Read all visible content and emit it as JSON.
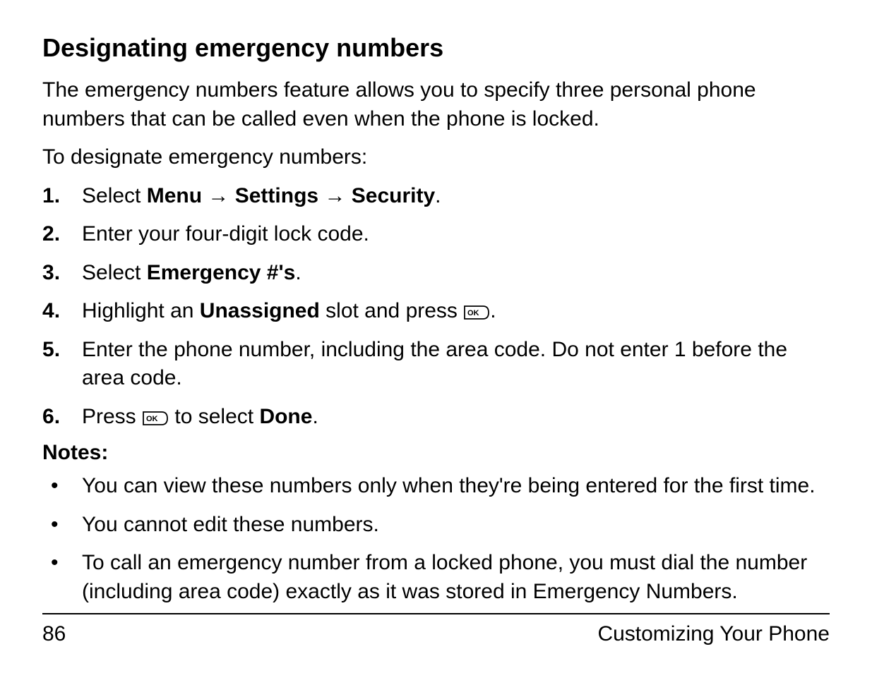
{
  "section_title": "Designating emergency numbers",
  "intro": "The emergency numbers feature allows you to specify three personal phone numbers that can be called even when the phone is locked.",
  "lead_in": "To designate emergency numbers:",
  "arrow": "→",
  "steps": {
    "s1": {
      "t1": "Select ",
      "b1": "Menu",
      "t2": " ",
      "b2": "Settings",
      "t3": " ",
      "b3": "Security",
      "t4": "."
    },
    "s2": {
      "t1": "Enter your four-digit lock code."
    },
    "s3": {
      "t1": "Select ",
      "b1": "Emergency #'s",
      "t2": "."
    },
    "s4": {
      "t1": "Highlight an ",
      "b1": "Unassigned",
      "t2": " slot and press ",
      "t3": "."
    },
    "s5": {
      "t1": "Enter the phone number, including the area code. Do not enter 1 before the area code."
    },
    "s6": {
      "t1": "Press ",
      "t2": " to select ",
      "b1": "Done",
      "t3": "."
    }
  },
  "notes_label": "Notes:",
  "notes": {
    "n1": "You can view these numbers only when they're being entered for the first time.",
    "n2": "You cannot edit these numbers.",
    "n3": "To call an emergency number from a locked phone, you must dial the number (including area code) exactly as it was stored in Emergency Numbers."
  },
  "footer": {
    "page_number": "86",
    "section": "Customizing Your Phone"
  },
  "icons": {
    "ok": "OK"
  }
}
